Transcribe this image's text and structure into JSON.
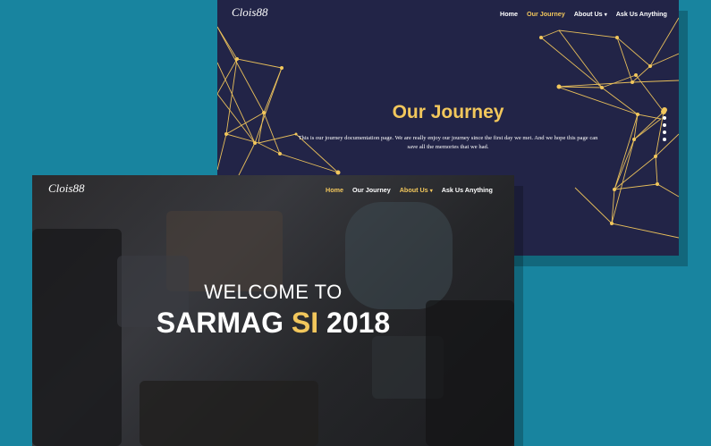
{
  "colors": {
    "background": "#18849f",
    "navy": "#222447",
    "accent": "#f2c75c"
  },
  "back_page": {
    "brand": "Clois88",
    "nav": {
      "home": "Home",
      "our_journey": "Our Journey",
      "about_us": "About Us",
      "ask_us": "Ask Us Anything",
      "active": "our_journey"
    },
    "title": "Our Journey",
    "description": "This is our journey documentation page. We are really enjoy our journey since the first day we met. And we hope this page can save all the memories that we had.",
    "slide_count": 5,
    "active_slide": 1
  },
  "front_page": {
    "brand": "Clois88",
    "nav": {
      "home": "Home",
      "our_journey": "Our Journey",
      "about_us": "About Us",
      "ask_us": "Ask Us Anything",
      "active": "home"
    },
    "heading_line1": "WELCOME TO",
    "heading_part1": "SARMAG",
    "heading_highlight": "SI",
    "heading_part2": "2018",
    "background_image": "people-working-on-laptops-photo"
  },
  "icons": {
    "dropdown": "chevron-down-icon"
  }
}
